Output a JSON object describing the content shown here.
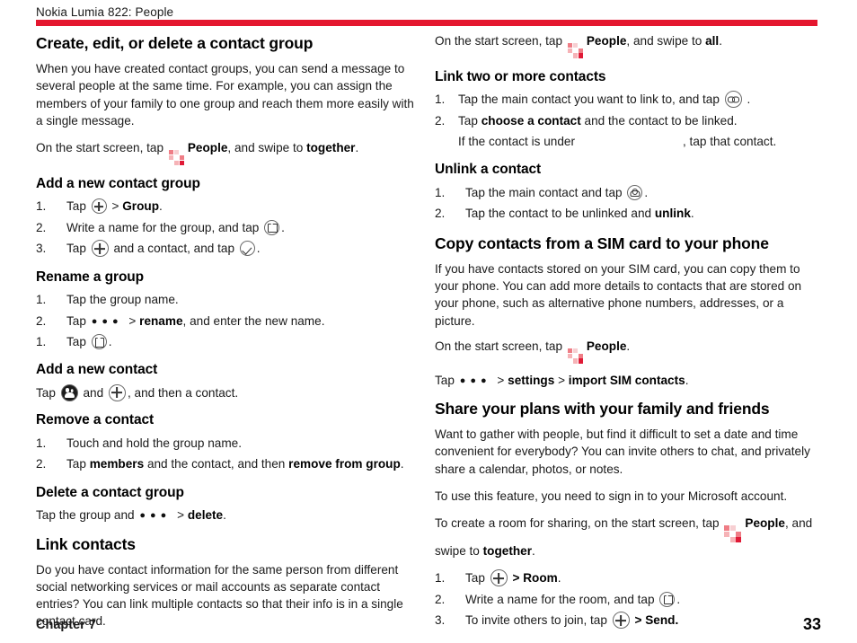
{
  "header": {
    "title": "Nokia Lumia 822: People",
    "rule_color": "#e4172f"
  },
  "footer": {
    "chapter": "Chapter 7",
    "page_number": "33"
  },
  "icons": {
    "people_tile": "people-tile-icon",
    "plus": "circle-plus-icon",
    "save": "circle-save-icon",
    "check": "circle-check-icon",
    "link": "circle-link-icon",
    "unlink": "circle-unlink-icon",
    "people_circle": "circle-people-icon",
    "more_dots": "more-dots-icon"
  },
  "tile_colors": {
    "pale": "#f7cfd2",
    "light": "#f6b3b7",
    "mid": "#ef7d86",
    "strong": "#e8505f",
    "deep": "#e01a36",
    "white": "#ffffff"
  },
  "left": {
    "section_title": "Create, edit, or delete a contact group",
    "intro": "When you have created contact groups, you can send a message to several people at the same time. For example, you can assign the members of your family to one group and reach them more easily with a single message.",
    "start_screen": {
      "prefix": "On the start screen, tap",
      "app": "People",
      "mid": ", and swipe to",
      "target": "together",
      "suffix": "."
    },
    "add_group": {
      "heading": "Add a new contact group",
      "steps": [
        {
          "num": "1.",
          "pre": "Tap",
          "post_symbol": ">",
          "bold": "Group",
          "tail": "."
        },
        {
          "num": "2.",
          "pre": "Write a name for the group, and tap",
          "tail": "."
        },
        {
          "num": "3.",
          "pre": "Tap",
          "mid": "and a contact, and tap",
          "tail": "."
        }
      ]
    },
    "rename_group": {
      "heading": "Rename a group",
      "steps": [
        {
          "num": "1.",
          "text": "Tap the group name."
        },
        {
          "num": "2.",
          "pre": "Tap",
          "arrow": ">",
          "bold": "rename",
          "tail": ", and enter the new name."
        },
        {
          "num": "1.",
          "pre": "Tap",
          "tail": "."
        }
      ]
    },
    "add_contact": {
      "heading": "Add a new contact",
      "pre": "Tap",
      "mid": "and",
      "tail": ", and then a contact."
    },
    "remove_contact": {
      "heading": "Remove a contact",
      "steps": [
        {
          "num": "1.",
          "text": "Touch and hold the group name."
        },
        {
          "num": "2.",
          "pre": "Tap",
          "bold1": "members",
          "mid": "and the contact, and then",
          "bold2": "remove from group",
          "tail": "."
        }
      ]
    },
    "delete_group": {
      "heading": "Delete a contact group",
      "pre": "Tap the group and",
      "arrow": ">",
      "bold": "delete",
      "tail": "."
    },
    "link_contacts": {
      "heading": "Link contacts",
      "body": "Do you have contact information for the same person from different social networking services or mail accounts as separate contact entries? You can link multiple contacts so that their info is in a single contact card."
    }
  },
  "right": {
    "start_screen": {
      "prefix": "On the start screen, tap",
      "app": "People",
      "mid": ", and swipe to",
      "target": "all",
      "suffix": "."
    },
    "link_two": {
      "heading": "Link two or more contacts",
      "steps": [
        {
          "num": "1.",
          "pre": "Tap the main contact you want to link to, and tap",
          "tail": "."
        },
        {
          "num": "2.",
          "pre": "Tap",
          "bold": "choose a contact",
          "tail": "and the contact to be linked."
        }
      ],
      "continuation_pre": "If the contact is under",
      "continuation_post": ", tap that contact."
    },
    "unlink": {
      "heading": "Unlink a contact",
      "steps": [
        {
          "num": "1.",
          "pre": "Tap the main contact and tap",
          "tail": "."
        },
        {
          "num": "2.",
          "pre": "Tap the contact to be unlinked and",
          "bold": "unlink",
          "tail": "."
        }
      ]
    },
    "sim": {
      "heading": "Copy contacts from a SIM card to your phone",
      "body": "If you have contacts stored on your SIM card, you can copy them to your phone. You can add more details to contacts that are stored on your phone, such as alternative phone numbers, addresses, or a picture.",
      "start_prefix": "On the start screen, tap",
      "start_app": "People",
      "start_suffix": ".",
      "menu_pre": "Tap",
      "menu_arrow1": ">",
      "menu_item1": "settings",
      "menu_arrow2": ">",
      "menu_item2": "import SIM contacts",
      "menu_tail": "."
    },
    "share": {
      "heading": "Share your plans with your family and friends",
      "body1": "Want to gather with people, but find it difficult to set a date and time convenient for everybody? You can invite others to chat, and privately share a calendar, photos, or notes.",
      "body2": "To use this feature, you need to sign in to your Microsoft account.",
      "room_prefix": "To create a room for sharing, on the start screen, tap",
      "room_app": "People",
      "room_mid": ", and swipe to",
      "room_target": "together",
      "room_suffix": ".",
      "steps": [
        {
          "num": "1.",
          "pre": "Tap",
          "arrow": "> ",
          "bold": "Room",
          "tail": "."
        },
        {
          "num": "2.",
          "pre": "Write a name for the room, and tap",
          "tail": "."
        },
        {
          "num": "3.",
          "pre": "To invite others to join, tap",
          "arrow": "> ",
          "bold": "Send.",
          "tail": ""
        }
      ]
    }
  }
}
